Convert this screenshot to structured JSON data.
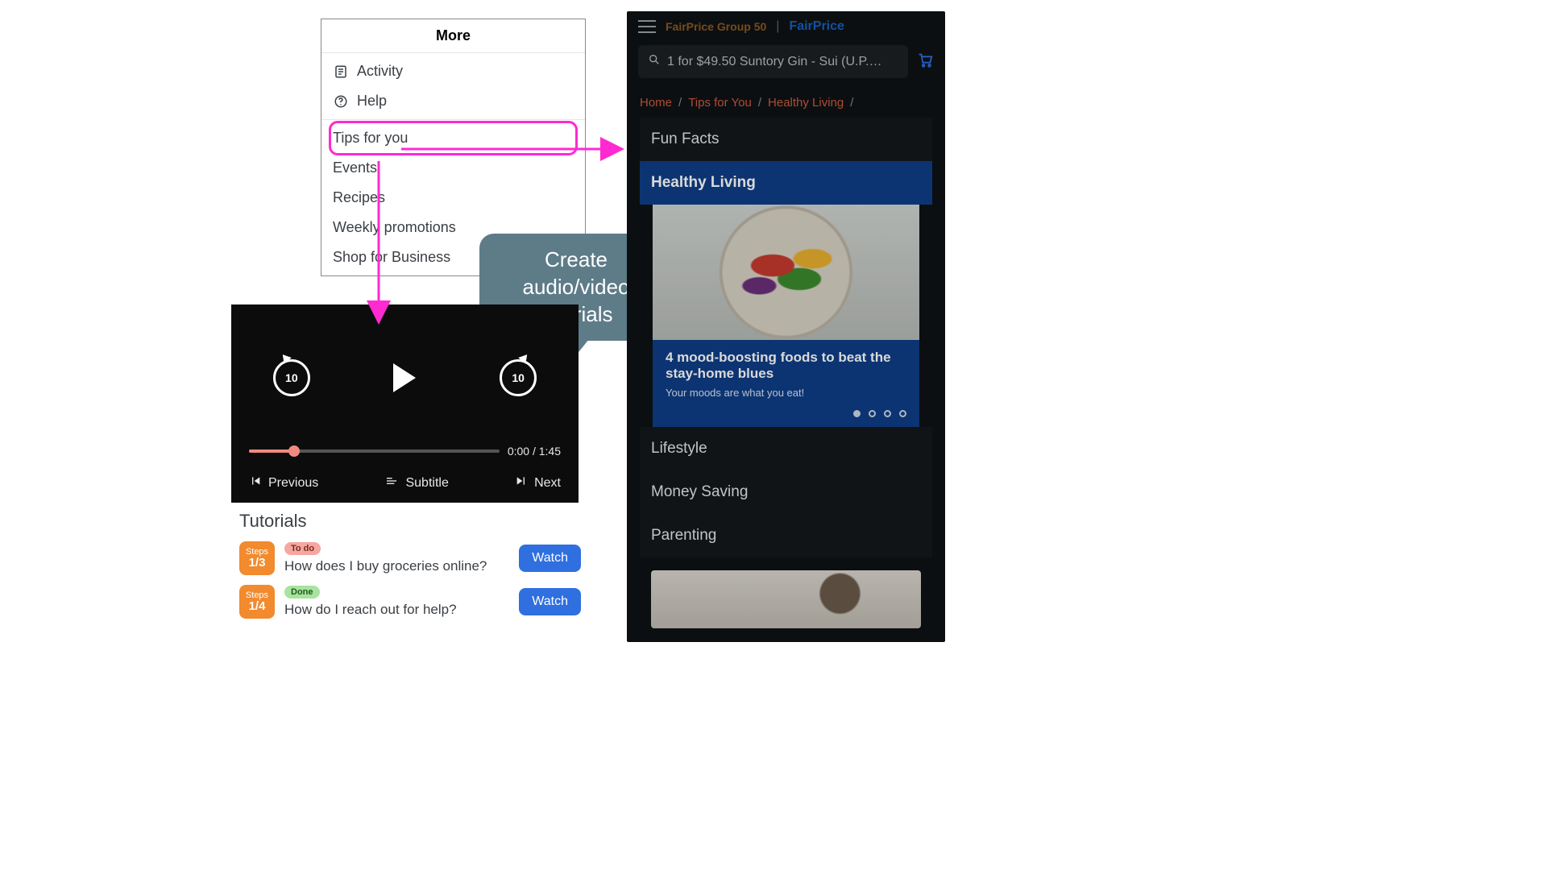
{
  "more_menu": {
    "title": "More",
    "activity": "Activity",
    "help": "Help",
    "tips": "Tips for you",
    "events": "Events",
    "recipes": "Recipes",
    "weekly": "Weekly promotions",
    "shop_biz": "Shop for Business"
  },
  "callout": {
    "text": "Create audio/video tutorials"
  },
  "player": {
    "rewind_seconds": "10",
    "forward_seconds": "10",
    "time_current": "0:00",
    "time_total": "1:45",
    "time_display": "0:00 / 1:45",
    "btn_previous": "Previous",
    "btn_subtitle": "Subtitle",
    "btn_next": "Next",
    "progress_percent": 18
  },
  "tutorials": {
    "heading": "Tutorials",
    "watch_label": "Watch",
    "items": [
      {
        "step_label": "Steps",
        "step_frac": "1/3",
        "status": "To do",
        "status_kind": "todo",
        "title": "How does I buy groceries online?"
      },
      {
        "step_label": "Steps",
        "step_frac": "1/4",
        "status": "Done",
        "status_kind": "done",
        "title": "How do I reach out for help?"
      }
    ]
  },
  "mobile": {
    "brand1": "FairPrice Group 50",
    "brand2": "FairPrice",
    "search_placeholder": "1 for $49.50 Suntory Gin - Sui (U.P. …",
    "breadcrumbs": [
      "Home",
      "Tips for You",
      "Healthy Living"
    ],
    "categories": [
      "Fun Facts",
      "Healthy Living",
      "Lifestyle",
      "Money Saving",
      "Parenting"
    ],
    "active_category_index": 1,
    "hero": {
      "title": "4 mood-boosting foods to beat the stay-home blues",
      "subtitle": "Your moods are what you eat!",
      "dot_count": 4,
      "active_dot": 0
    }
  },
  "arrows": {
    "color": "#ff2ad1"
  }
}
